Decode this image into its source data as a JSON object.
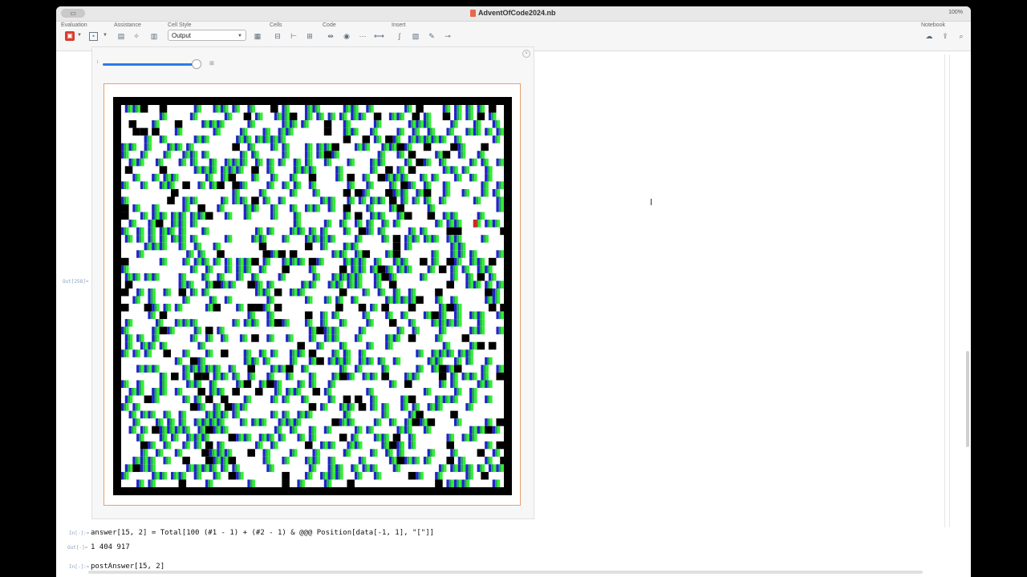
{
  "window": {
    "title": "AdventOfCode2024.nb",
    "zoom": "100%"
  },
  "toolbar": {
    "groups": {
      "evaluation": "Evaluation",
      "assistance": "Assistance",
      "cell_style": "Cell Style",
      "cells": "Cells",
      "code": "Code",
      "insert": "Insert",
      "notebook": "Notebook"
    },
    "cell_style_value": "Output"
  },
  "notebook": {
    "output_label": "Out[258]=",
    "input_label": "In[-]:=",
    "input_line": "answer[15, 2] = Total[100 (#1 - 1) + (#2 - 1) & @@@ Position[data[-1, 1], \"[\"]]",
    "result_label": "Out[-]=",
    "result_value": "1 404 917",
    "next_input": "postAnswer[15, 2]"
  },
  "grid_data": {
    "description_colors": {
      "wall": "#000000",
      "empty": "#ffffff",
      "box_left": "#2222cc",
      "box_mid": "#22aa55",
      "box_right": "#33ee33",
      "robot": "#dd2222"
    },
    "width": 100,
    "height": 50,
    "slider_fraction": 0.97
  },
  "colors": {
    "accent": "#2c7be5",
    "selection": "#e6a070",
    "evaluate": "#d93b2e"
  }
}
